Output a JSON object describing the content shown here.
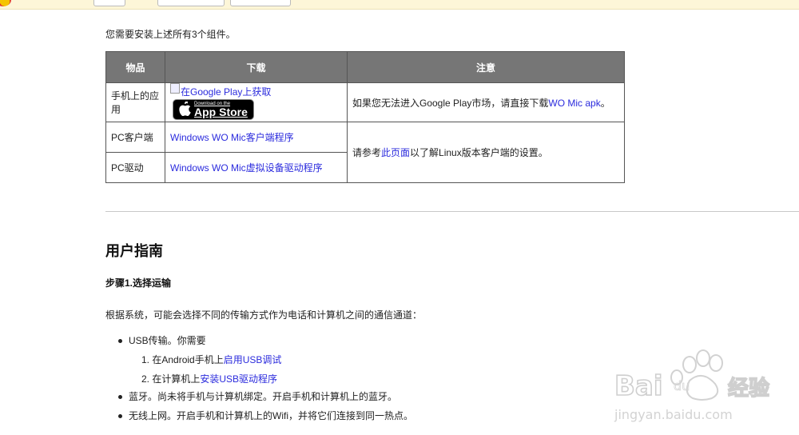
{
  "intro_text": "您需要安装上述所有3个组件。",
  "table": {
    "headers": [
      "物品",
      "下载",
      "注意"
    ],
    "row_phone": {
      "item": "手机上的应用",
      "google_play_alt": "在Google Play上获取",
      "app_store": {
        "small": "Download on the",
        "big": "App Store"
      },
      "note_prefix": "如果您无法进入Google Play市场，请直接下载",
      "note_link": "WO Mic apk",
      "note_suffix": "。"
    },
    "row_pc_client": {
      "item": "PC客户端",
      "link": "Windows WO Mic客户端程序"
    },
    "row_pc_driver": {
      "item": "PC驱动",
      "link": "Windows WO Mic虚拟设备驱动程序"
    },
    "merged_note": {
      "prefix": "请参考",
      "link": "此页面",
      "suffix": "以了解Linux版本客户端的设置。"
    }
  },
  "guide": {
    "title": "用户指南",
    "step1_title": "步骤1.选择运输",
    "intro": "根据系统，可能会选择不同的传输方式作为电话和计算机之间的通信通道：",
    "usb": {
      "text": "USB传输。你需要",
      "sub": [
        {
          "prefix": "1. 在Android手机上",
          "link": "启用USB调试"
        },
        {
          "prefix": "2. 在计算机上",
          "link": "安装USB驱动程序"
        }
      ]
    },
    "bluetooth": "蓝牙。尚未将手机与计算机绑定。开启手机和计算机上的蓝牙。",
    "wifi": "无线上网。开启手机和计算机上的Wifi，并将它们连接到同一热点。"
  },
  "colors": {
    "link": "#2b2bdd",
    "header_bg": "#767676",
    "topbar_bg": "#fdf6d8"
  },
  "icons": {
    "apple": "apple-logo-icon",
    "broken_image": "broken-image-icon"
  }
}
